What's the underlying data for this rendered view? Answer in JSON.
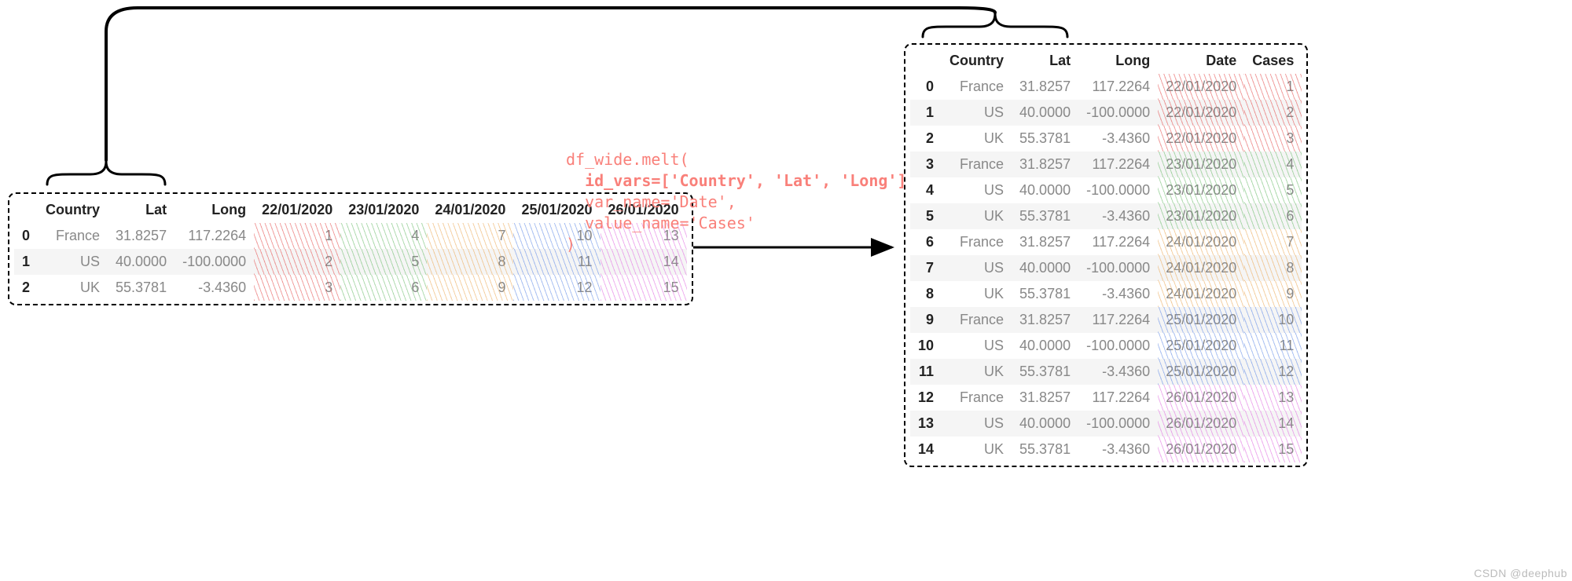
{
  "chart_data": {
    "type": "table",
    "operation": "pandas.DataFrame.melt",
    "code": "df_wide.melt(\n  id_vars=['Country', 'Lat', 'Long'],\n  var_name='Date',\n  value_name='Cases'\n)",
    "wide": {
      "columns": [
        "Country",
        "Lat",
        "Long",
        "22/01/2020",
        "23/01/2020",
        "24/01/2020",
        "25/01/2020",
        "26/01/2020"
      ],
      "index": [
        0,
        1,
        2
      ],
      "rows": [
        [
          "France",
          31.8257,
          117.2264,
          1,
          4,
          7,
          10,
          13
        ],
        [
          "US",
          40.0,
          -100.0,
          2,
          5,
          8,
          11,
          14
        ],
        [
          "UK",
          55.3781,
          -3.436,
          3,
          6,
          9,
          12,
          15
        ]
      ],
      "date_color_map": {
        "22/01/2020": "red",
        "23/01/2020": "green",
        "24/01/2020": "orange",
        "25/01/2020": "blue",
        "26/01/2020": "magenta"
      }
    },
    "long": {
      "columns": [
        "Country",
        "Lat",
        "Long",
        "Date",
        "Cases"
      ],
      "index": [
        0,
        1,
        2,
        3,
        4,
        5,
        6,
        7,
        8,
        9,
        10,
        11,
        12,
        13,
        14
      ],
      "rows": [
        [
          "France",
          31.8257,
          117.2264,
          "22/01/2020",
          1
        ],
        [
          "US",
          40.0,
          -100.0,
          "22/01/2020",
          2
        ],
        [
          "UK",
          55.3781,
          -3.436,
          "22/01/2020",
          3
        ],
        [
          "France",
          31.8257,
          117.2264,
          "23/01/2020",
          4
        ],
        [
          "US",
          40.0,
          -100.0,
          "23/01/2020",
          5
        ],
        [
          "UK",
          55.3781,
          -3.436,
          "23/01/2020",
          6
        ],
        [
          "France",
          31.8257,
          117.2264,
          "24/01/2020",
          7
        ],
        [
          "US",
          40.0,
          -100.0,
          "24/01/2020",
          8
        ],
        [
          "UK",
          55.3781,
          -3.436,
          "24/01/2020",
          9
        ],
        [
          "France",
          31.8257,
          117.2264,
          "25/01/2020",
          10
        ],
        [
          "US",
          40.0,
          -100.0,
          "25/01/2020",
          11
        ],
        [
          "UK",
          55.3781,
          -3.436,
          "25/01/2020",
          12
        ],
        [
          "France",
          31.8257,
          117.2264,
          "26/01/2020",
          13
        ],
        [
          "US",
          40.0,
          -100.0,
          "26/01/2020",
          14
        ],
        [
          "UK",
          55.3781,
          -3.436,
          "26/01/2020",
          15
        ]
      ]
    }
  },
  "colors": {
    "red": "rgba(228, 80, 80, 0.55)",
    "green": "rgba(110, 190, 110, 0.55)",
    "orange": "rgba(235, 170, 90, 0.55)",
    "blue": "rgba(100, 140, 230, 0.55)",
    "magenta": "rgba(225, 110, 225, 0.55)"
  },
  "code_lines": {
    "l0": "df_wide.melt(",
    "l1": "  id_vars=['Country', 'Lat', 'Long'],",
    "l2": "  var_name='Date',",
    "l3": "  value_name='Cases'",
    "l4": ")"
  },
  "wide_headers": {
    "idx": "",
    "c0": "Country",
    "c1": "Lat",
    "c2": "Long",
    "c3": "22/01/2020",
    "c4": "23/01/2020",
    "c5": "24/01/2020",
    "c6": "25/01/2020",
    "c7": "26/01/2020"
  },
  "wide_idx": {
    "r0": "0",
    "r1": "1",
    "r2": "2"
  },
  "wide": {
    "r0": {
      "c0": "France",
      "c1": "31.8257",
      "c2": "117.2264",
      "c3": "1",
      "c4": "4",
      "c5": "7",
      "c6": "10",
      "c7": "13"
    },
    "r1": {
      "c0": "US",
      "c1": "40.0000",
      "c2": "-100.0000",
      "c3": "2",
      "c4": "5",
      "c5": "8",
      "c6": "11",
      "c7": "14"
    },
    "r2": {
      "c0": "UK",
      "c1": "55.3781",
      "c2": "-3.4360",
      "c3": "3",
      "c4": "6",
      "c5": "9",
      "c6": "12",
      "c7": "15"
    }
  },
  "long_headers": {
    "idx": "",
    "c0": "Country",
    "c1": "Lat",
    "c2": "Long",
    "c3": "Date",
    "c4": "Cases"
  },
  "long_idx": {
    "r0": "0",
    "r1": "1",
    "r2": "2",
    "r3": "3",
    "r4": "4",
    "r5": "5",
    "r6": "6",
    "r7": "7",
    "r8": "8",
    "r9": "9",
    "r10": "10",
    "r11": "11",
    "r12": "12",
    "r13": "13",
    "r14": "14"
  },
  "long": {
    "r0": {
      "c0": "France",
      "c1": "31.8257",
      "c2": "117.2264",
      "c3": "22/01/2020",
      "c4": "1"
    },
    "r1": {
      "c0": "US",
      "c1": "40.0000",
      "c2": "-100.0000",
      "c3": "22/01/2020",
      "c4": "2"
    },
    "r2": {
      "c0": "UK",
      "c1": "55.3781",
      "c2": "-3.4360",
      "c3": "22/01/2020",
      "c4": "3"
    },
    "r3": {
      "c0": "France",
      "c1": "31.8257",
      "c2": "117.2264",
      "c3": "23/01/2020",
      "c4": "4"
    },
    "r4": {
      "c0": "US",
      "c1": "40.0000",
      "c2": "-100.0000",
      "c3": "23/01/2020",
      "c4": "5"
    },
    "r5": {
      "c0": "UK",
      "c1": "55.3781",
      "c2": "-3.4360",
      "c3": "23/01/2020",
      "c4": "6"
    },
    "r6": {
      "c0": "France",
      "c1": "31.8257",
      "c2": "117.2264",
      "c3": "24/01/2020",
      "c4": "7"
    },
    "r7": {
      "c0": "US",
      "c1": "40.0000",
      "c2": "-100.0000",
      "c3": "24/01/2020",
      "c4": "8"
    },
    "r8": {
      "c0": "UK",
      "c1": "55.3781",
      "c2": "-3.4360",
      "c3": "24/01/2020",
      "c4": "9"
    },
    "r9": {
      "c0": "France",
      "c1": "31.8257",
      "c2": "117.2264",
      "c3": "25/01/2020",
      "c4": "10"
    },
    "r10": {
      "c0": "US",
      "c1": "40.0000",
      "c2": "-100.0000",
      "c3": "25/01/2020",
      "c4": "11"
    },
    "r11": {
      "c0": "UK",
      "c1": "55.3781",
      "c2": "-3.4360",
      "c3": "25/01/2020",
      "c4": "12"
    },
    "r12": {
      "c0": "France",
      "c1": "31.8257",
      "c2": "117.2264",
      "c3": "26/01/2020",
      "c4": "13"
    },
    "r13": {
      "c0": "US",
      "c1": "40.0000",
      "c2": "-100.0000",
      "c3": "26/01/2020",
      "c4": "14"
    },
    "r14": {
      "c0": "UK",
      "c1": "55.3781",
      "c2": "-3.4360",
      "c3": "26/01/2020",
      "c4": "15"
    }
  },
  "watermark": "CSDN @deephub"
}
